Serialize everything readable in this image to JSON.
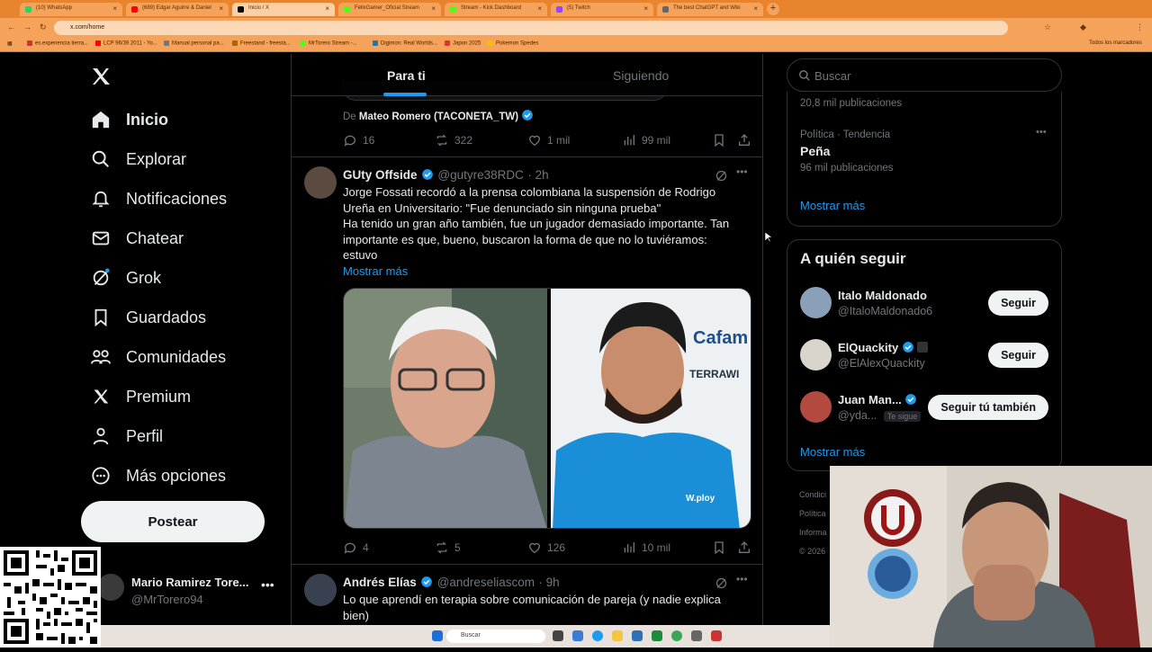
{
  "browser": {
    "tabs": [
      {
        "label": "(10) WhatsApp",
        "color": "#25d366"
      },
      {
        "label": "(689) Edgar Aguirre & Daniel",
        "color": "#ff0000"
      },
      {
        "label": "Inicio / X",
        "color": "#000000"
      },
      {
        "label": "FelixGamer_Oficial Stream",
        "color": "#53fc18"
      },
      {
        "label": "Stream - Kick Dashboard",
        "color": "#53fc18"
      },
      {
        "label": "(5) Twitch",
        "color": "#9146ff"
      },
      {
        "label": "The best ChatGPT and Wiki",
        "color": "#666666"
      }
    ],
    "active_tab": 2,
    "url": "x.com/home",
    "bookmarks": [
      "es.experiencia tierra...",
      "LCP 96/39 2011 - Yo...",
      "Manual personal pa...",
      "Freestand - freesta...",
      "MrTorero Stream -...",
      "Digimon: Real Worlds...",
      "Japon 2025",
      "Pokemon Spedes"
    ],
    "all_bookmarks_label": "Todos los marcadores"
  },
  "nav": {
    "items": [
      {
        "label": "Inicio",
        "icon": "home-icon"
      },
      {
        "label": "Explorar",
        "icon": "search-icon"
      },
      {
        "label": "Notificaciones",
        "icon": "bell-icon"
      },
      {
        "label": "Chatear",
        "icon": "mail-icon"
      },
      {
        "label": "Grok",
        "icon": "grok-icon"
      },
      {
        "label": "Guardados",
        "icon": "bookmark-icon"
      },
      {
        "label": "Comunidades",
        "icon": "communities-icon"
      },
      {
        "label": "Premium",
        "icon": "x-logo-icon"
      },
      {
        "label": "Perfil",
        "icon": "person-icon"
      },
      {
        "label": "Más opciones",
        "icon": "more-circle-icon"
      }
    ],
    "post_label": "Postear",
    "account": {
      "name": "Mario Ramirez Tore...",
      "handle": "@MrTorero94"
    }
  },
  "feed": {
    "tabs": [
      "Para ti",
      "Siguiendo"
    ],
    "prev_post": {
      "from_prefix": "De",
      "from_name": "Mateo Romero (TACONETA_TW)",
      "replies": "16",
      "reposts": "322",
      "likes": "1 mil",
      "views": "99 mil"
    },
    "post1": {
      "name": "GUty Offside",
      "handle": "@gutyre38RDC",
      "time": "· 2h",
      "lines": [
        "Jorge Fossati recordó a la prensa colombiana la suspensión de Rodrigo",
        "Ureña en Universitario: \"Fue denunciado sin ninguna prueba\"",
        "Ha tenido un gran año también, fue un jugador demasiado importante. Tan",
        "importante es que, bueno, buscaron la forma de que no lo tuviéramos:",
        "estuvo"
      ],
      "show_more": "Mostrar más",
      "image_texts": [
        "Cafam",
        "TERRAWI",
        "W.ploy"
      ],
      "replies": "4",
      "reposts": "5",
      "likes": "126",
      "views": "10 mil"
    },
    "post2": {
      "name": "Andrés Elías",
      "handle": "@andreseliascom",
      "time": "· 9h",
      "lines": [
        "Lo que aprendí en terapia sobre comunicación de pareja (y nadie explica",
        "bien)"
      ]
    }
  },
  "sidebar": {
    "search_placeholder": "Buscar",
    "trends": {
      "first_count": "20,8 mil publicaciones",
      "second_meta": "Política · Tendencia",
      "second_name": "Peña",
      "second_count": "96 mil publicaciones",
      "show_more": "Mostrar más"
    },
    "who_to_follow": {
      "title": "A quién seguir",
      "users": [
        {
          "name": "Italo Maldonado",
          "handle": "@ItaloMaldonado6",
          "button": "Seguir"
        },
        {
          "name": "ElQuackity",
          "handle": "@ElAlexQuackity",
          "button": "Seguir"
        },
        {
          "name": "Juan Man...",
          "handle": "@yda...",
          "badge": "Te sigue",
          "button": "Seguir tú también"
        }
      ],
      "show_more": "Mostrar más"
    },
    "footer": [
      "Condici",
      "Política",
      "Informa",
      "© 2026"
    ]
  },
  "taskbar": {
    "search_label": "Buscar"
  },
  "colors": {
    "accent": "#1d9bf0",
    "browser": "#e8832e",
    "background": "#000000"
  }
}
